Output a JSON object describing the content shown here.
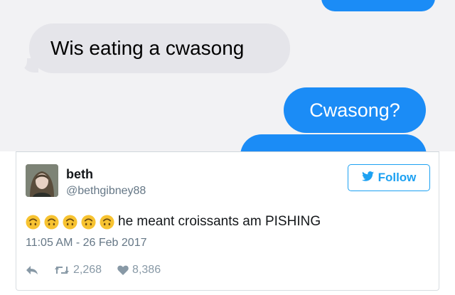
{
  "messages": {
    "incoming": "Wis eating a cwasong",
    "outgoing": "Cwasong?"
  },
  "tweet": {
    "display_name": "beth",
    "handle": "@bethgibney88",
    "follow_label": "Follow",
    "emojis": [
      "upside-down-face",
      "upside-down-face",
      "upside-down-face",
      "upside-down-face",
      "upside-down-face"
    ],
    "text": "he meant croissants am PISHING",
    "timestamp": "11:05 AM - 26 Feb 2017",
    "retweet_count": "2,268",
    "like_count": "8,386"
  },
  "colors": {
    "imessage_blue": "#1b8cf6",
    "imessage_gray": "#e5e5ea",
    "twitter_blue": "#1da1f2",
    "emoji_yellow": "#f7c331"
  },
  "icons": {
    "reply": "reply-icon",
    "retweet": "retweet-icon",
    "like": "heart-icon",
    "follow": "twitter-bird-icon"
  }
}
